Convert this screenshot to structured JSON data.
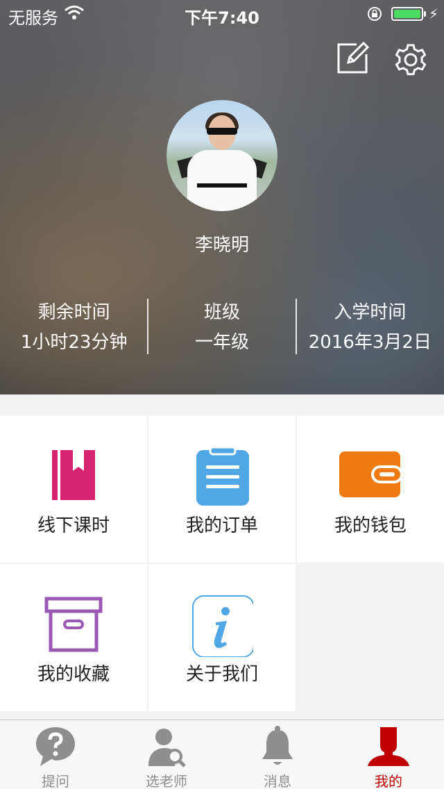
{
  "status_bar": {
    "carrier": "无服务",
    "time": "下午7:40"
  },
  "header": {
    "edit_icon": "edit-icon",
    "settings_icon": "gear-icon",
    "username": "李晓明",
    "stats": [
      {
        "label": "剩余时间",
        "value": "1小时23分钟"
      },
      {
        "label": "班级",
        "value": "一年级"
      },
      {
        "label": "入学时间",
        "value": "2016年3月2日"
      }
    ]
  },
  "menu": {
    "items": [
      {
        "label": "线下课时",
        "icon": "bookmark-book-icon",
        "color": "#d6246f"
      },
      {
        "label": "我的订单",
        "icon": "clipboard-icon",
        "color": "#4fa7e6"
      },
      {
        "label": "我的钱包",
        "icon": "wallet-icon",
        "color": "#f07a12"
      },
      {
        "label": "我的收藏",
        "icon": "archive-box-icon",
        "color": "#9b59b6"
      },
      {
        "label": "关于我们",
        "icon": "info-icon",
        "color": "#4fa7e6"
      }
    ]
  },
  "tabbar": {
    "tabs": [
      {
        "label": "提问",
        "icon": "question-bubble-icon",
        "active": false
      },
      {
        "label": "选老师",
        "icon": "teacher-search-icon",
        "active": false
      },
      {
        "label": "消息",
        "icon": "bell-icon",
        "active": false
      },
      {
        "label": "我的",
        "icon": "user-icon",
        "active": true
      }
    ],
    "active_color": "#c00000",
    "inactive_color": "#8e8e8e"
  }
}
